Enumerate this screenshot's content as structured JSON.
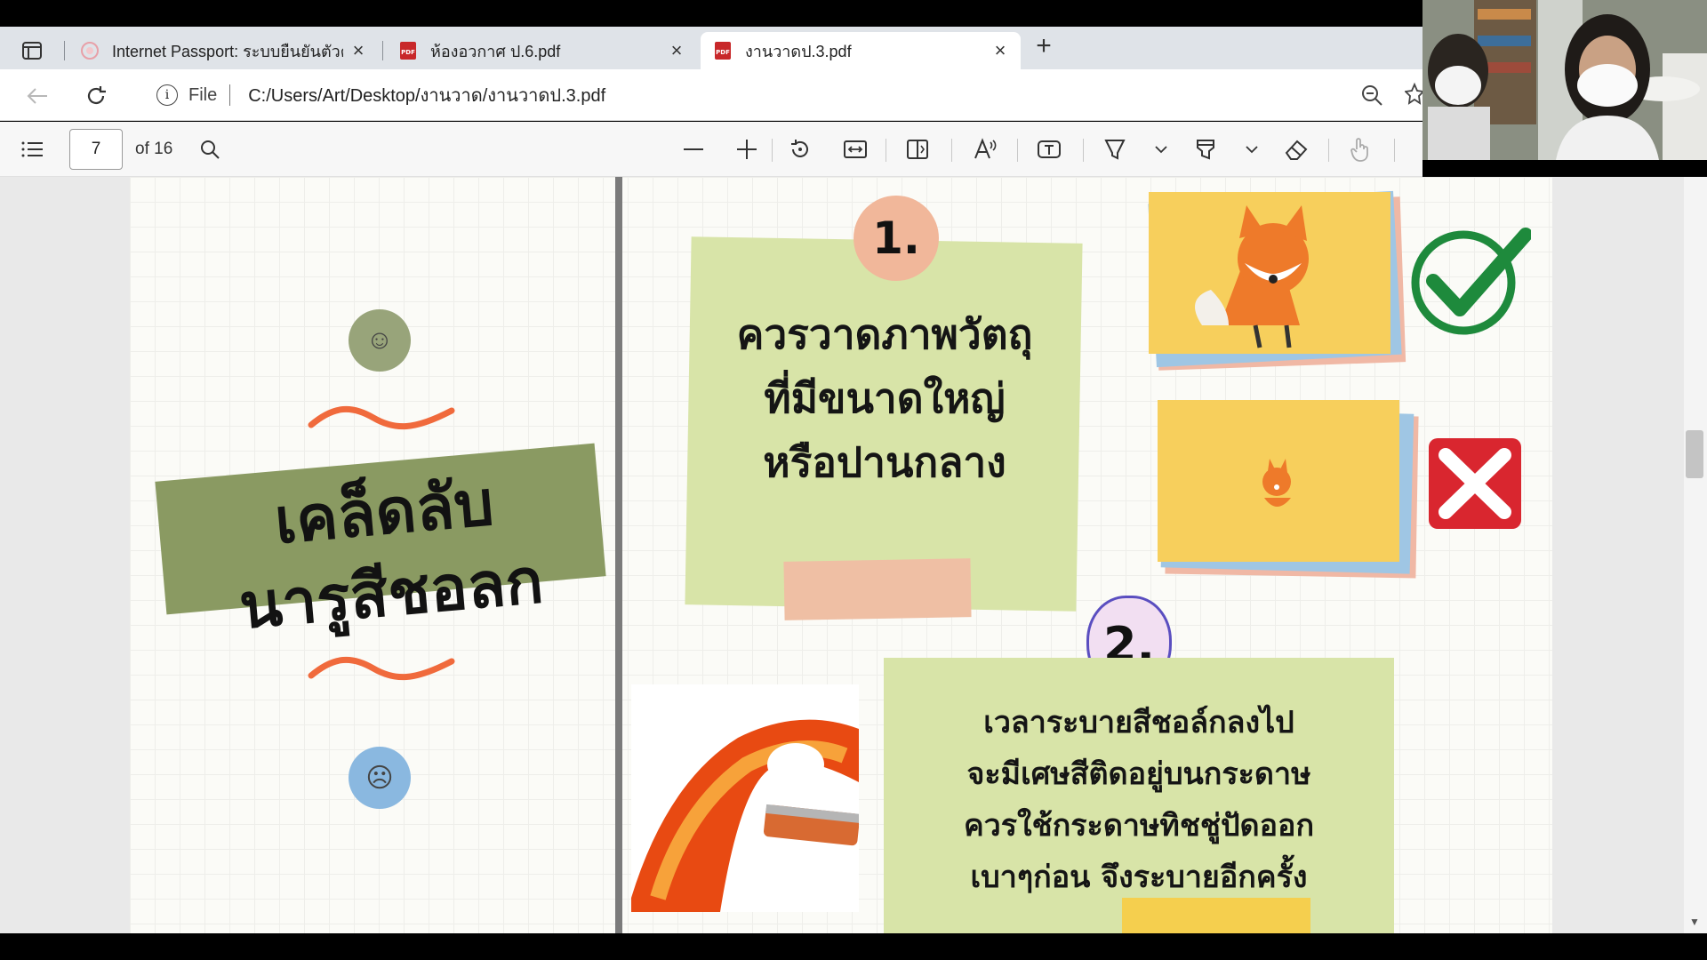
{
  "tabs": [
    {
      "title": "Internet Passport: ระบบยืนยันตัวตน",
      "favicon": "passport-icon",
      "active": false
    },
    {
      "title": "ห้องอวกาศ ป.6.pdf",
      "favicon": "pdf-icon",
      "active": false
    },
    {
      "title": "งานวาดป.3.pdf",
      "favicon": "pdf-icon",
      "active": true
    }
  ],
  "address": {
    "scheme_label": "File",
    "url": "C:/Users/Art/Desktop/งานวาด/งานวาดป.3.pdf"
  },
  "pdf_toolbar": {
    "page_number": "7",
    "page_total": "of 16"
  },
  "page_content": {
    "left_title": "เคล็ดลับ\nนารูสีชอลก",
    "step1_number": "1.",
    "step1_text": "ควรวาดภาพวัตถุ\nที่มีขนาดใหญ่\nหรือปานกลาง",
    "step2_number": "2.",
    "step2_text": "เวลาระบายสีชอล์กลงไป\nจะมีเศษสีติดอยู่บนกระดาษ\nควรใช้กระดาษทิชชู่ปัดออก\nเบาๆก่อน จึงระบายอีกครั้ง"
  },
  "colors": {
    "accent_green": "#8a9a62",
    "note_green": "#d8e4a8",
    "check_green": "#1e8a3c",
    "cross_red": "#d9262f",
    "card_yellow": "#f7cf5c"
  }
}
